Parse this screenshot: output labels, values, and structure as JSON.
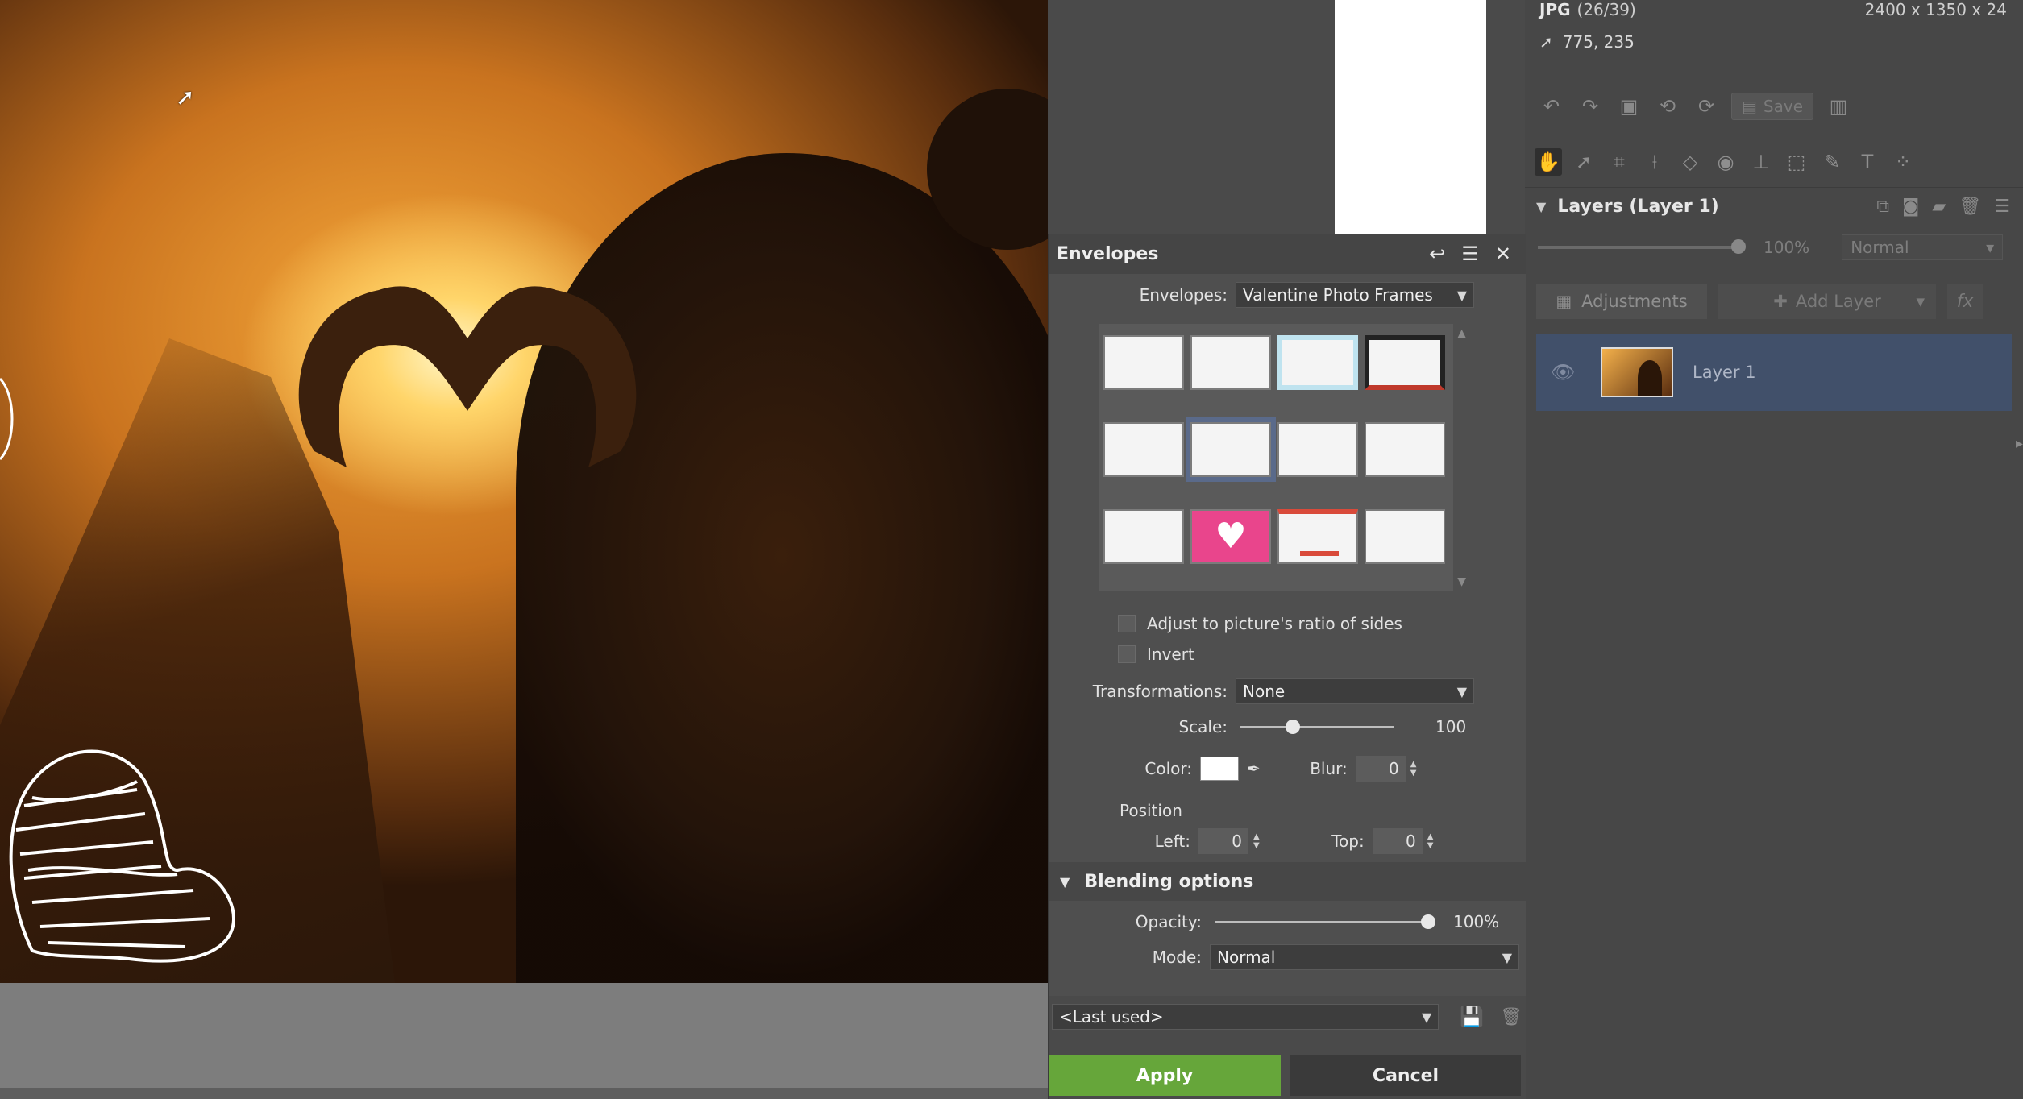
{
  "image_info": {
    "format": "JPG",
    "index": "(26/39)",
    "dimensions": "2400 x 1350 x 24",
    "cursor_coords": "775, 235"
  },
  "toolbar": {
    "save_label": "Save"
  },
  "layers": {
    "header": "Layers (Layer 1)",
    "opacity": "100%",
    "blend_mode": "Normal",
    "adjustments_label": "Adjustments",
    "add_layer_label": "Add Layer",
    "fx_label": "fx",
    "items": [
      {
        "name": "Layer 1"
      }
    ]
  },
  "dialog": {
    "title": "Envelopes",
    "envelopes_label": "Envelopes:",
    "envelopes_value": "Valentine Photo Frames",
    "adjust_ratio_label": "Adjust to picture's ratio of sides",
    "invert_label": "Invert",
    "transformations_label": "Transformations:",
    "transformations_value": "None",
    "scale_label": "Scale:",
    "scale_value": "100",
    "scale_fraction": 0.34,
    "color_label": "Color:",
    "color_value": "#ffffff",
    "blur_label": "Blur:",
    "blur_value": "0",
    "position_label": "Position",
    "left_label": "Left:",
    "left_value": "0",
    "top_label": "Top:",
    "top_value": "0",
    "blending_label": "Blending options",
    "opacity_label": "Opacity:",
    "opacity_value": "100%",
    "mode_label": "Mode:",
    "mode_value": "Normal",
    "preset_value": "<Last used>",
    "apply_label": "Apply",
    "cancel_label": "Cancel"
  },
  "colors": {
    "apply": "#66a63a",
    "selected_layer": "#41506a",
    "panel": "#474747"
  }
}
